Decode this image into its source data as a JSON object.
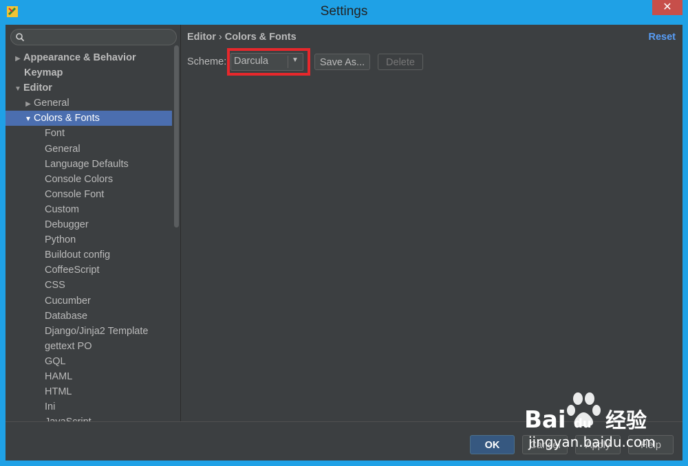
{
  "window": {
    "title": "Settings",
    "close_label": "✕"
  },
  "sidebar": {
    "search": {
      "placeholder": "",
      "value": ""
    },
    "items": [
      {
        "label": "Appearance & Behavior",
        "level": 0,
        "arrow": "▶",
        "bold": true
      },
      {
        "label": "Keymap",
        "level": 0,
        "arrow": "",
        "bold": true
      },
      {
        "label": "Editor",
        "level": 0,
        "arrow": "▼",
        "bold": true
      },
      {
        "label": "General",
        "level": 1,
        "arrow": "▶"
      },
      {
        "label": "Colors & Fonts",
        "level": 1,
        "arrow": "▼",
        "selected": true
      },
      {
        "label": "Font",
        "level": 2
      },
      {
        "label": "General",
        "level": 2
      },
      {
        "label": "Language Defaults",
        "level": 2
      },
      {
        "label": "Console Colors",
        "level": 2
      },
      {
        "label": "Console Font",
        "level": 2
      },
      {
        "label": "Custom",
        "level": 2
      },
      {
        "label": "Debugger",
        "level": 2
      },
      {
        "label": "Python",
        "level": 2
      },
      {
        "label": "Buildout config",
        "level": 2
      },
      {
        "label": "CoffeeScript",
        "level": 2
      },
      {
        "label": "CSS",
        "level": 2
      },
      {
        "label": "Cucumber",
        "level": 2
      },
      {
        "label": "Database",
        "level": 2
      },
      {
        "label": "Django/Jinja2 Template",
        "level": 2
      },
      {
        "label": "gettext PO",
        "level": 2
      },
      {
        "label": "GQL",
        "level": 2
      },
      {
        "label": "HAML",
        "level": 2
      },
      {
        "label": "HTML",
        "level": 2
      },
      {
        "label": "Ini",
        "level": 2
      },
      {
        "label": "JavaScript",
        "level": 2
      }
    ]
  },
  "main": {
    "breadcrumb": {
      "parent": "Editor",
      "separator": "›",
      "current": "Colors & Fonts"
    },
    "reset_label": "Reset",
    "scheme": {
      "label": "Scheme:",
      "value": "Darcula",
      "caret": "▼"
    },
    "save_as_label": "Save As...",
    "delete_label": "Delete"
  },
  "footer": {
    "ok_label": "OK",
    "cancel_label": "Cancel",
    "apply_label": "Apply",
    "help_label": "Help"
  },
  "watermark": {
    "brand": "Bai",
    "brand_tail": "du",
    "cn": "经验",
    "url": "jingyan.baidu.com"
  },
  "colors": {
    "titlebar": "#1fa1e6",
    "background": "#3c3f41",
    "selection": "#4b6eaf",
    "link": "#589df6",
    "highlight_box": "#e7282c",
    "default_button": "#365880"
  }
}
